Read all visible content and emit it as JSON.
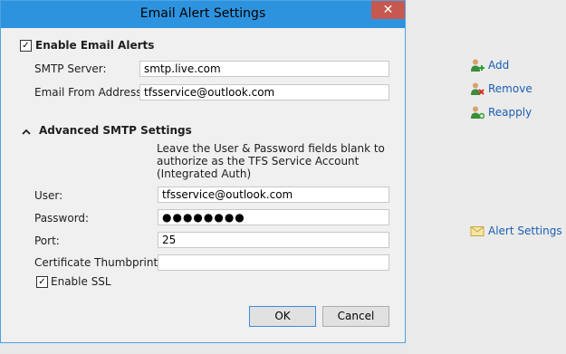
{
  "dialog": {
    "title": "Email Alert Settings",
    "close_glyph": "✕",
    "enable_alerts": {
      "label": "Enable Email Alerts",
      "checked": true
    },
    "smtp_server": {
      "label": "SMTP Server:",
      "value": "smtp.live.com"
    },
    "from_address": {
      "label": "Email From Address:",
      "value": "tfsservice@outlook.com"
    },
    "advanced": {
      "label": "Advanced SMTP Settings",
      "note": "Leave the User & Password fields blank to authorize as the TFS Service Account (Integrated Auth)",
      "user": {
        "label": "User:",
        "value": "tfsservice@outlook.com"
      },
      "password": {
        "label": "Password:",
        "value": "●●●●●●●●"
      },
      "port": {
        "label": "Port:",
        "value": "25"
      },
      "thumbprint": {
        "label": "Certificate Thumbprint:",
        "value": ""
      },
      "enable_ssl": {
        "label": "Enable SSL",
        "checked": true
      }
    },
    "ok_label": "OK",
    "cancel_label": "Cancel"
  },
  "side_actions": {
    "add": "Add",
    "remove": "Remove",
    "reapply": "Reapply",
    "alert_settings": "Alert Settings"
  },
  "colors": {
    "title_bar": "#2e93df",
    "close_button": "#c7584f",
    "link": "#1a5fb4"
  }
}
